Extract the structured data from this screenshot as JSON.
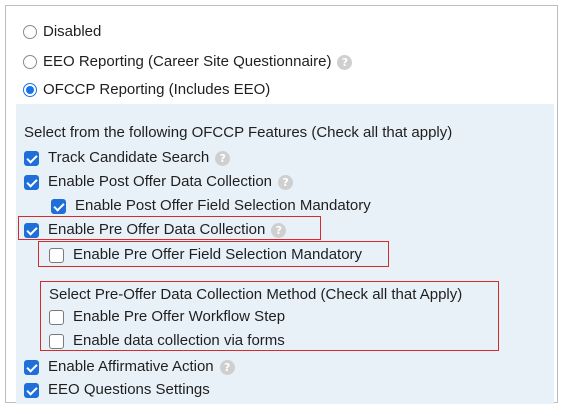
{
  "reporting_options": [
    {
      "label": "Disabled",
      "selected": false,
      "help": false
    },
    {
      "label": "EEO Reporting (Career Site Questionnaire)",
      "selected": false,
      "help": true
    },
    {
      "label": "OFCCP Reporting (Includes EEO)",
      "selected": true,
      "help": false
    }
  ],
  "features": {
    "heading": "Select from the following OFCCP Features (Check all that apply)",
    "track_candidate_search": {
      "label": "Track Candidate Search",
      "checked": true
    },
    "post_offer": {
      "label": "Enable Post Offer Data Collection",
      "checked": true
    },
    "post_offer_mandatory": {
      "label": "Enable Post Offer Field Selection Mandatory",
      "checked": true
    },
    "pre_offer": {
      "label": "Enable Pre Offer Data Collection",
      "checked": true
    },
    "pre_offer_mandatory": {
      "label": "Enable Pre Offer Field Selection Mandatory",
      "checked": false
    },
    "method_heading": "Select Pre-Offer Data Collection Method (Check all that Apply)",
    "pre_offer_workflow": {
      "label": "Enable Pre Offer Workflow Step",
      "checked": false
    },
    "data_forms": {
      "label": "Enable data collection via forms",
      "checked": false
    },
    "affirmative_action": {
      "label": "Enable Affirmative Action",
      "checked": true
    },
    "eeo_questions": {
      "label": "EEO Questions Settings",
      "checked": true
    }
  },
  "help_glyph": "?",
  "colors": {
    "accent": "#1e6fd9",
    "highlight_box": "#d42b2b",
    "panel_bg": "#e9f1f8"
  }
}
